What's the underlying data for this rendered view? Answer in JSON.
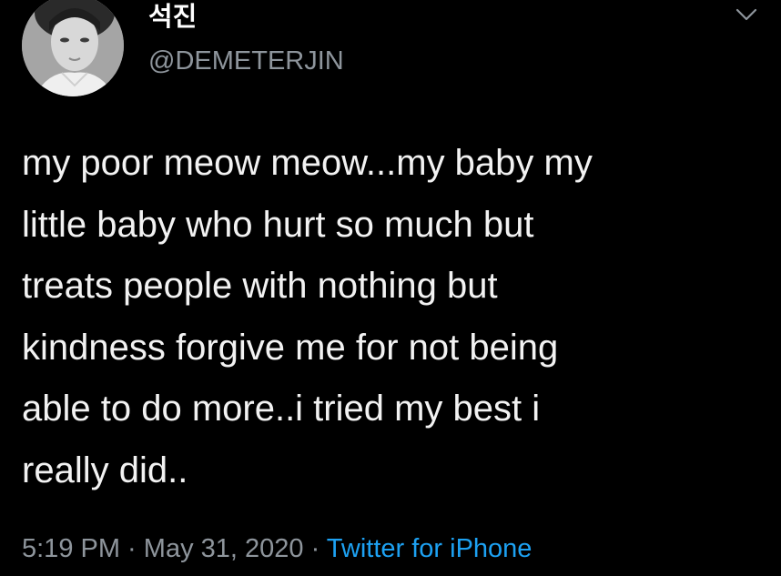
{
  "user": {
    "display_name": "석진",
    "handle": "@DEMETERJIN"
  },
  "tweet": {
    "lines": [
      "my poor meow meow...my baby my",
      "little baby who hurt so much but",
      "treats people with nothing but",
      "kindness forgive me for not being",
      "able to do more..i tried my best i",
      "really did.."
    ]
  },
  "meta": {
    "time": "5:19 PM",
    "separator1": " · ",
    "date": "May 31, 2020",
    "separator2": " · ",
    "source": "Twitter for iPhone"
  },
  "icons": {
    "menu": "chevron-down-icon"
  },
  "colors": {
    "background": "#000000",
    "text": "#f2f2f2",
    "secondary": "#8e959c",
    "link": "#1da1f2"
  }
}
